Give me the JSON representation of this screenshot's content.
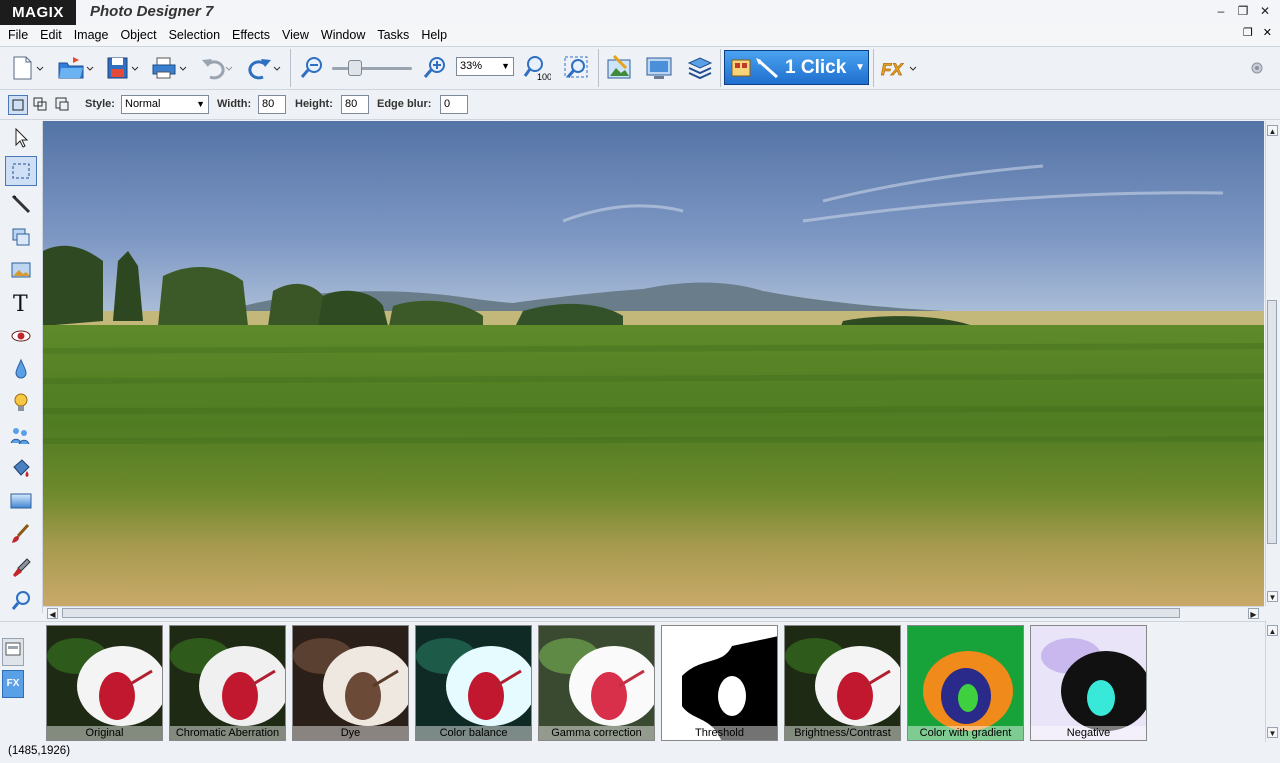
{
  "app": {
    "logo": "MAGIX",
    "title": "Photo Designer 7"
  },
  "window_controls": [
    "minimize-icon",
    "restore-icon",
    "close-icon"
  ],
  "menu": [
    "File",
    "Edit",
    "Image",
    "Object",
    "Selection",
    "Effects",
    "View",
    "Window",
    "Tasks",
    "Help"
  ],
  "toolbar": {
    "zoom_value": "33%",
    "zoom_100_label": "100",
    "one_click_label": "1 Click"
  },
  "options": {
    "style_label": "Style:",
    "style_value": "Normal",
    "width_label": "Width:",
    "width_value": "80",
    "height_label": "Height:",
    "height_value": "80",
    "edge_blur_label": "Edge blur:",
    "edge_blur_value": "0"
  },
  "effects": [
    {
      "label": "Original"
    },
    {
      "label": "Chromatic Aberration"
    },
    {
      "label": "Dye"
    },
    {
      "label": "Color balance"
    },
    {
      "label": "Gamma correction"
    },
    {
      "label": "Threshold"
    },
    {
      "label": "Brightness/Contrast"
    },
    {
      "label": "Color with gradient"
    },
    {
      "label": "Negative"
    }
  ],
  "status": {
    "coords": "(1485,1926)"
  },
  "colors": {
    "accent": "#1f6fce",
    "chrome": "#eef1f6"
  }
}
